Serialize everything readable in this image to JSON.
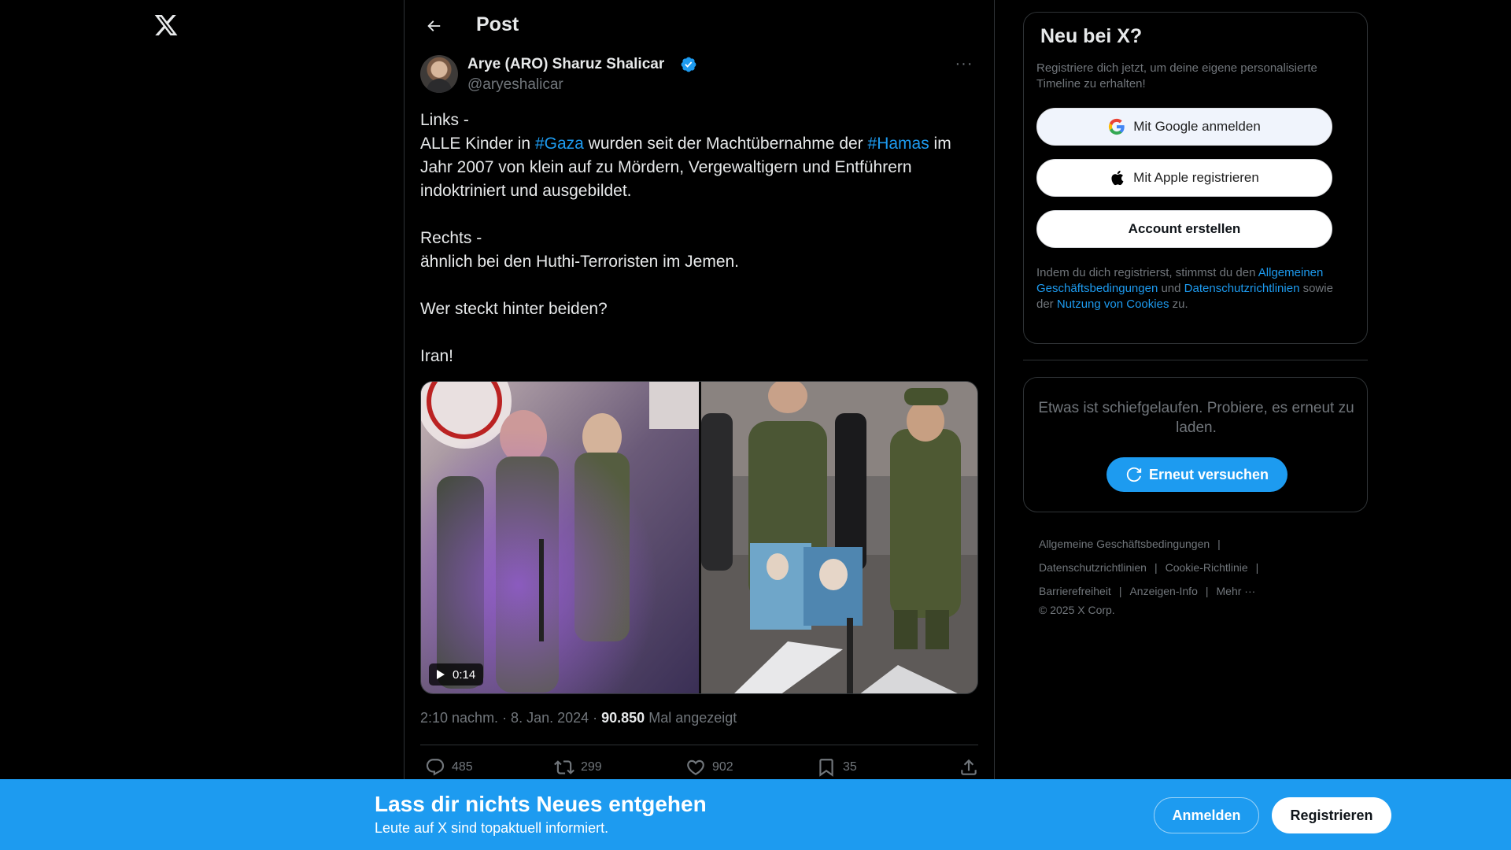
{
  "header": {
    "title": "Post"
  },
  "author": {
    "name": "Arye (ARO) Sharuz Shalicar",
    "handle": "@aryeshalicar",
    "more": "···"
  },
  "tweet": {
    "line1": "Links -",
    "line2_a": "ALLE Kinder in ",
    "hashtag_gaza": "#Gaza",
    "line2_b": " wurden seit der Machtübernahme der ",
    "hashtag_hamas": "#Hamas",
    "line2_c": " im Jahr 2007 von klein auf zu Mördern, Vergewaltigern und Entführern indoktriniert und ausgebildet.",
    "line3": "Rechts -",
    "line4": "ähnlich bei den Huthi-Terroristen im Jemen.",
    "line5": "Wer steckt hinter beiden?",
    "line6": "Iran!"
  },
  "media": {
    "duration": "0:14"
  },
  "meta": {
    "time_date": "2:10 nachm. · 8. Jan. 2024 · ",
    "views": "90.850",
    "views_label": " Mal angezeigt"
  },
  "actions": {
    "replies": "485",
    "reposts": "299",
    "likes": "902",
    "bookmarks": "35"
  },
  "signup": {
    "title": "Neu bei X?",
    "subtitle": "Registriere dich jetzt, um deine eigene personalisierte Timeline zu erhalten!",
    "google_label": "Mit Google anmelden",
    "apple_label": "Mit Apple registrieren",
    "create_label": "Account erstellen",
    "legal_a": "Indem du dich registrierst, stimmst du den ",
    "legal_link_terms": "Allgemeinen Geschäftsbedingungen",
    "legal_b": " und ",
    "legal_link_privacy": "Datenschutzrichtlinien",
    "legal_c": " sowie der ",
    "legal_link_cookies": "Nutzung von Cookies",
    "legal_d": " zu."
  },
  "error": {
    "text": "Etwas ist schiefgelaufen. Probiere, es erneut zu laden.",
    "retry_label": "Erneut versuchen"
  },
  "footer": {
    "terms": "Allgemeine Geschäftsbedingungen",
    "privacy": "Datenschutzrichtlinien",
    "cookies": "Cookie-Richtlinie",
    "accessibility": "Barrierefreiheit",
    "ads_info": "Anzeigen-Info",
    "more": "Mehr ···",
    "separator": "|",
    "copyright": "© 2025 X Corp."
  },
  "banner": {
    "title": "Lass dir nichts Neues entgehen",
    "subtitle": "Leute auf X sind topaktuell informiert.",
    "login_label": "Anmelden",
    "register_label": "Registrieren"
  },
  "colors": {
    "accent": "#1d9bf0",
    "background": "#000000",
    "text": "#e7e9ea",
    "muted": "#71767b",
    "border": "#2f3336"
  }
}
